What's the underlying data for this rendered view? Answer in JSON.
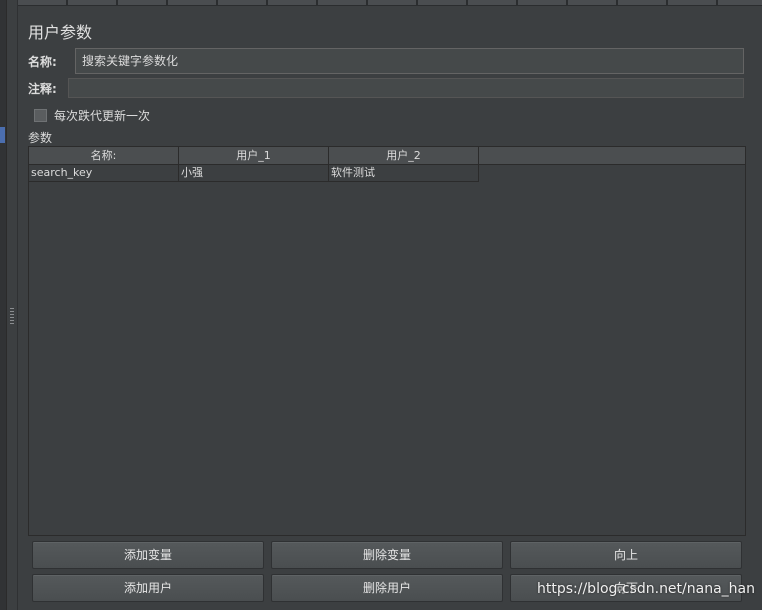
{
  "panel": {
    "title": "用户参数"
  },
  "name_field": {
    "label": "名称:",
    "value": "搜索关键字参数化"
  },
  "comment_field": {
    "label": "注释:",
    "value": ""
  },
  "iteration_checkbox": {
    "label": "每次跌代更新一次",
    "checked": false
  },
  "parameters": {
    "label": "参数",
    "columns": [
      "名称:",
      "用户_1",
      "用户_2"
    ],
    "rows": [
      [
        "search_key",
        "小强",
        "软件测试"
      ]
    ]
  },
  "buttons": {
    "add_variable": "添加变量",
    "delete_variable": "删除变量",
    "move_up": "向上",
    "add_user": "添加用户",
    "delete_user": "删除用户",
    "move_down": "向下"
  },
  "watermark": "https://blog.csdn.net/nana_han",
  "colors": {
    "background": "#3c3f41",
    "accent": "#4b6eaf"
  }
}
